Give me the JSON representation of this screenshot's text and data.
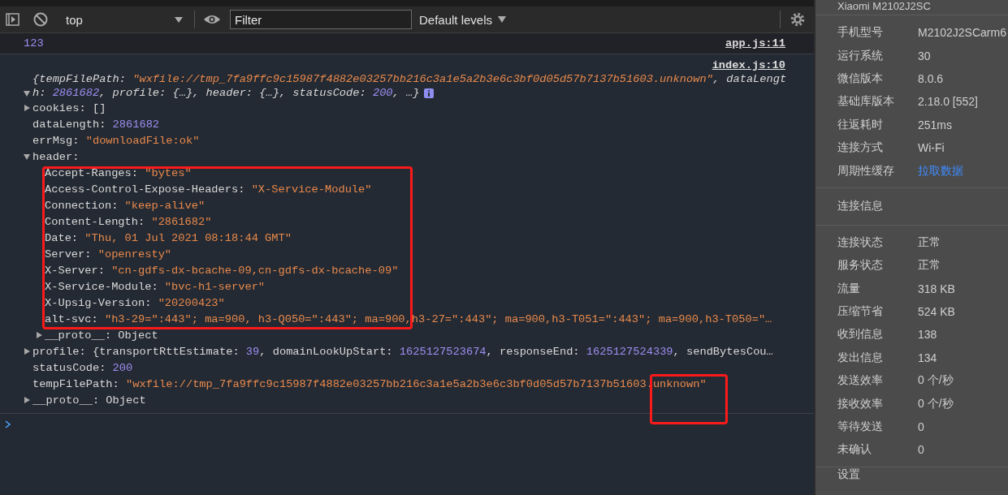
{
  "toolbar": {
    "context": "top",
    "filter": {
      "placeholder": "Filter"
    },
    "levels": "Default levels"
  },
  "console": {
    "messages": [
      {
        "kind": "value",
        "text": "123",
        "source": "app.js:11"
      },
      {
        "kind": "object",
        "source": "index.js:10",
        "tree": {
          "kind": "node",
          "expanded": true,
          "summary": [
            [
              {
                "text": "{tempFilePath: ",
                "kind": "key"
              },
              {
                "text": "\"wxfile://tmp_7fa9ffc9c15987f4882e03257bb216c3a1e5a2b3e6c3bf0d05d57b7137b51603.unknown\"",
                "kind": "str"
              },
              {
                "text": ", dataLengt",
                "kind": "key"
              }
            ],
            [
              {
                "text": "h: ",
                "kind": "key"
              },
              {
                "text": "2861682",
                "kind": "num"
              },
              {
                "text": ", profile: {…}, header: {…}, statusCode: ",
                "kind": "key"
              },
              {
                "text": "200",
                "kind": "num"
              },
              {
                "text": ", …}",
                "kind": "key"
              }
            ]
          ],
          "children": [
            {
              "kind": "node",
              "expanded": false,
              "key": "cookies:",
              "value": [
                {
                  "text": "[]",
                  "kind": "key"
                }
              ]
            },
            {
              "kind": "leaf",
              "key": "dataLength:",
              "value": [
                {
                  "text": "2861682",
                  "kind": "num"
                }
              ]
            },
            {
              "kind": "leaf",
              "key": "errMsg:",
              "value": [
                {
                  "text": "\"downloadFile:ok\"",
                  "kind": "str"
                }
              ]
            },
            {
              "kind": "node",
              "expanded": true,
              "key": "header:",
              "children": [
                {
                  "kind": "leaf",
                  "boxed": true,
                  "key": "Accept-Ranges:",
                  "value": [
                    {
                      "text": "\"bytes\"",
                      "kind": "str"
                    }
                  ]
                },
                {
                  "kind": "leaf",
                  "boxed": true,
                  "key": "Access-Control-Expose-Headers:",
                  "value": [
                    {
                      "text": "\"X-Service-Module\"",
                      "kind": "str"
                    }
                  ]
                },
                {
                  "kind": "leaf",
                  "boxed": true,
                  "key": "Connection:",
                  "value": [
                    {
                      "text": "\"keep-alive\"",
                      "kind": "str"
                    }
                  ]
                },
                {
                  "kind": "leaf",
                  "boxed": true,
                  "key": "Content-Length:",
                  "value": [
                    {
                      "text": "\"2861682\"",
                      "kind": "str"
                    }
                  ]
                },
                {
                  "kind": "leaf",
                  "boxed": true,
                  "key": "Date:",
                  "value": [
                    {
                      "text": "\"Thu, 01 Jul 2021 08:18:44 GMT\"",
                      "kind": "str"
                    }
                  ]
                },
                {
                  "kind": "leaf",
                  "boxed": true,
                  "key": "Server:",
                  "value": [
                    {
                      "text": "\"openresty\"",
                      "kind": "str"
                    }
                  ]
                },
                {
                  "kind": "leaf",
                  "boxed": true,
                  "key": "X-Server:",
                  "value": [
                    {
                      "text": "\"cn-gdfs-dx-bcache-09,cn-gdfs-dx-bcache-09\"",
                      "kind": "str"
                    }
                  ]
                },
                {
                  "kind": "leaf",
                  "boxed": true,
                  "key": "X-Service-Module:",
                  "value": [
                    {
                      "text": "\"bvc-h1-server\"",
                      "kind": "str"
                    }
                  ]
                },
                {
                  "kind": "leaf",
                  "boxed": true,
                  "key": "X-Upsig-Version:",
                  "value": [
                    {
                      "text": "\"20200423\"",
                      "kind": "str"
                    }
                  ]
                },
                {
                  "kind": "leaf",
                  "boxed": true,
                  "key": "alt-svc:",
                  "value": [
                    {
                      "text": "\"h3-29=\":443\"; ma=900, h3-Q050=\":443\"; ma=900,h3-27=\":443\"; ma=900,h3-T051=\":443\"; ma=900,h3-T050=\"…",
                      "kind": "str"
                    }
                  ]
                },
                {
                  "kind": "node",
                  "expanded": false,
                  "boxed": false,
                  "key": "__proto__:",
                  "value": [
                    {
                      "text": "Object",
                      "kind": "key"
                    }
                  ]
                }
              ]
            },
            {
              "kind": "node",
              "expanded": false,
              "key": "profile:",
              "value": [
                {
                  "text": "{transportRttEstimate: ",
                  "kind": "key"
                },
                {
                  "text": "39",
                  "kind": "num"
                },
                {
                  "text": ", domainLookUpStart: ",
                  "kind": "key"
                },
                {
                  "text": "1625127523674",
                  "kind": "num"
                },
                {
                  "text": ", responseEnd: ",
                  "kind": "key"
                },
                {
                  "text": "1625127524339",
                  "kind": "num"
                },
                {
                  "text": ", sendBytesCou…",
                  "kind": "key"
                }
              ]
            },
            {
              "kind": "leaf",
              "key": "statusCode:",
              "value": [
                {
                  "text": "200",
                  "kind": "num"
                }
              ]
            },
            {
              "kind": "leaf",
              "key": "tempFilePath:",
              "value": [
                {
                  "text": "\"wxfile://tmp_7fa9ffc9c15987f4882e03257bb216c3a1e5a2b3e6c3bf0d05d57b7137b51603.",
                  "kind": "str"
                },
                {
                  "text": "unknown\"",
                  "kind": "str",
                  "boxed": true
                }
              ]
            },
            {
              "kind": "node",
              "expanded": false,
              "key": "__proto__:",
              "value": [
                {
                  "text": "Object",
                  "kind": "key"
                }
              ]
            }
          ]
        }
      }
    ]
  },
  "sidebar": {
    "device": "Xiaomi M2102J2SC",
    "sections": [
      {
        "rows": [
          {
            "label": "手机型号",
            "value": "M2102J2SCarm6",
            "kind": "text"
          },
          {
            "label": "运行系统",
            "value": "30",
            "kind": "text"
          },
          {
            "label": "微信版本",
            "value": "8.0.6",
            "kind": "text"
          },
          {
            "label": "基础库版本",
            "value": "2.18.0 [552]",
            "kind": "text"
          },
          {
            "label": "往返耗时",
            "value": "251ms",
            "kind": "text"
          },
          {
            "label": "连接方式",
            "value": "Wi-Fi",
            "kind": "text"
          },
          {
            "label": "周期性缓存",
            "value": "拉取数据",
            "kind": "link"
          }
        ]
      },
      {
        "title": "连接信息"
      },
      {
        "rows": [
          {
            "label": "连接状态",
            "value": "正常",
            "kind": "text"
          },
          {
            "label": "服务状态",
            "value": "正常",
            "kind": "text"
          },
          {
            "label": "流量",
            "value": "318 KB",
            "kind": "text"
          },
          {
            "label": "压缩节省",
            "value": "524 KB",
            "kind": "text"
          },
          {
            "label": "收到信息",
            "value": "138",
            "kind": "text"
          },
          {
            "label": "发出信息",
            "value": "134",
            "kind": "text"
          },
          {
            "label": "发送效率",
            "value": "0 个/秒",
            "kind": "text"
          },
          {
            "label": "接收效率",
            "value": "0 个/秒",
            "kind": "text"
          },
          {
            "label": "等待发送",
            "value": "0",
            "kind": "text"
          },
          {
            "label": "未确认",
            "value": "0",
            "kind": "text"
          }
        ]
      },
      {
        "title": "设置"
      }
    ]
  }
}
